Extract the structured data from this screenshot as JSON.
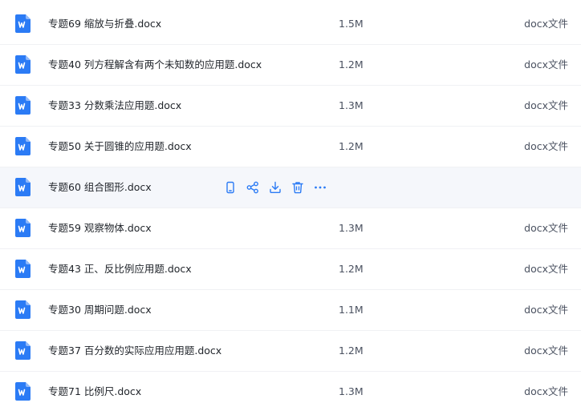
{
  "colors": {
    "accent": "#2b7bf5",
    "hover_row": "#f5f7fb",
    "divider": "#f0f1f4"
  },
  "row_actions": [
    {
      "icon": "phone-icon"
    },
    {
      "icon": "share-icon"
    },
    {
      "icon": "download-icon"
    },
    {
      "icon": "delete-icon"
    },
    {
      "icon": "more-icon"
    }
  ],
  "files": [
    {
      "name": "专题69 缩放与折叠.docx",
      "size": "1.5M",
      "type": "docx文件"
    },
    {
      "name": "专题40 列方程解含有两个未知数的应用题.docx",
      "size": "1.2M",
      "type": "docx文件"
    },
    {
      "name": "专题33 分数乘法应用题.docx",
      "size": "1.3M",
      "type": "docx文件"
    },
    {
      "name": "专题50 关于圆锥的应用题.docx",
      "size": "1.2M",
      "type": "docx文件"
    },
    {
      "name": "专题60 组合图形.docx",
      "size": "",
      "type": ""
    },
    {
      "name": "专题59 观察物体.docx",
      "size": "1.3M",
      "type": "docx文件"
    },
    {
      "name": "专题43 正、反比例应用题.docx",
      "size": "1.2M",
      "type": "docx文件"
    },
    {
      "name": "专题30 周期问题.docx",
      "size": "1.1M",
      "type": "docx文件"
    },
    {
      "name": "专题37 百分数的实际应用应用题.docx",
      "size": "1.2M",
      "type": "docx文件"
    },
    {
      "name": "专题71 比例尺.docx",
      "size": "1.3M",
      "type": "docx文件"
    }
  ]
}
